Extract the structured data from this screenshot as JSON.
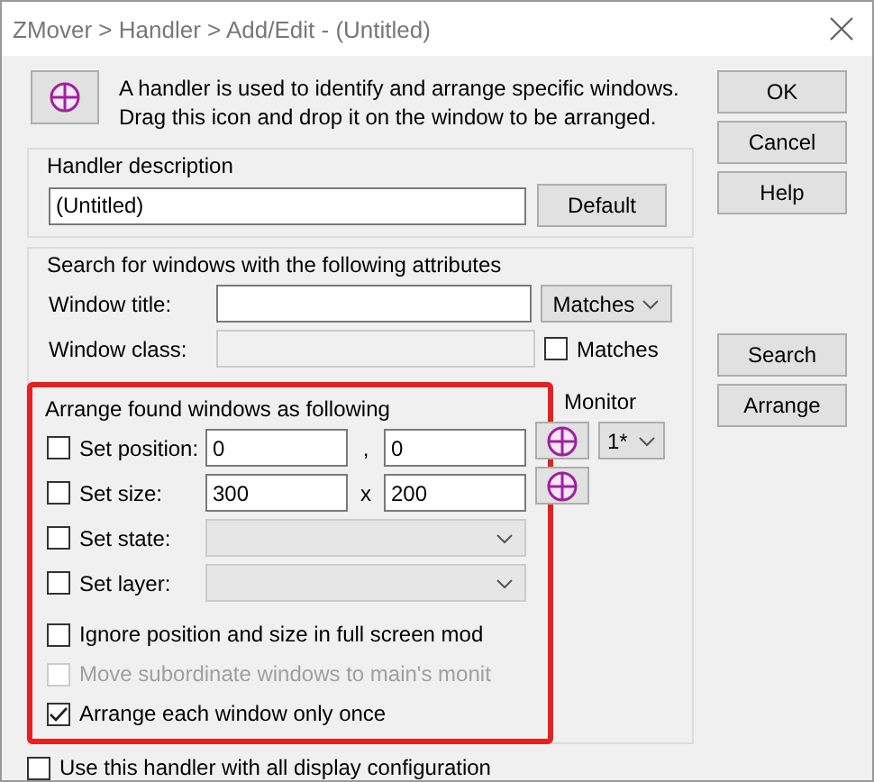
{
  "window": {
    "title": "ZMover > Handler > Add/Edit - (Untitled)"
  },
  "intro": "A handler is used to identify and arrange specific windows. Drag this icon and drop it on the window to be arranged.",
  "handler_description": {
    "label": "Handler description",
    "value": "(Untitled)",
    "button": "Default"
  },
  "search_group": {
    "label": "Search for windows with the following attributes",
    "window_title": {
      "label": "Window title:",
      "match": "Matches"
    },
    "window_class": {
      "label": "Window class:",
      "disabled": true,
      "match_label": "Matches",
      "match_checked": false
    }
  },
  "arrange_group": {
    "label": "Arrange found windows as following",
    "monitor_label": "Monitor",
    "monitor": "1*",
    "rows": [
      {
        "kind": "pair",
        "label": "Set position:",
        "checked": false,
        "first": "0",
        "separator": ",",
        "second": "0"
      },
      {
        "kind": "pair",
        "label": "Set size:",
        "checked": false,
        "first": "300",
        "separator": "x",
        "second": "200"
      },
      {
        "kind": "select",
        "label": "Set state:",
        "checked": false
      },
      {
        "kind": "select",
        "label": "Set layer:",
        "checked": false
      },
      {
        "kind": "check",
        "label": "Ignore position and size in full screen mod",
        "checked": false,
        "disabled": false
      },
      {
        "kind": "check",
        "label": "Move subordinate windows to main's monit",
        "checked": false,
        "disabled": true
      },
      {
        "kind": "check",
        "label": "Arrange each window only once",
        "checked": true,
        "disabled": false
      }
    ]
  },
  "dialog_buttons": [
    "OK",
    "Cancel",
    "Help"
  ],
  "action_buttons": [
    "Search",
    "Arrange"
  ],
  "bottom_option": {
    "label": "Use this handler with all display configuration",
    "checked": false
  }
}
